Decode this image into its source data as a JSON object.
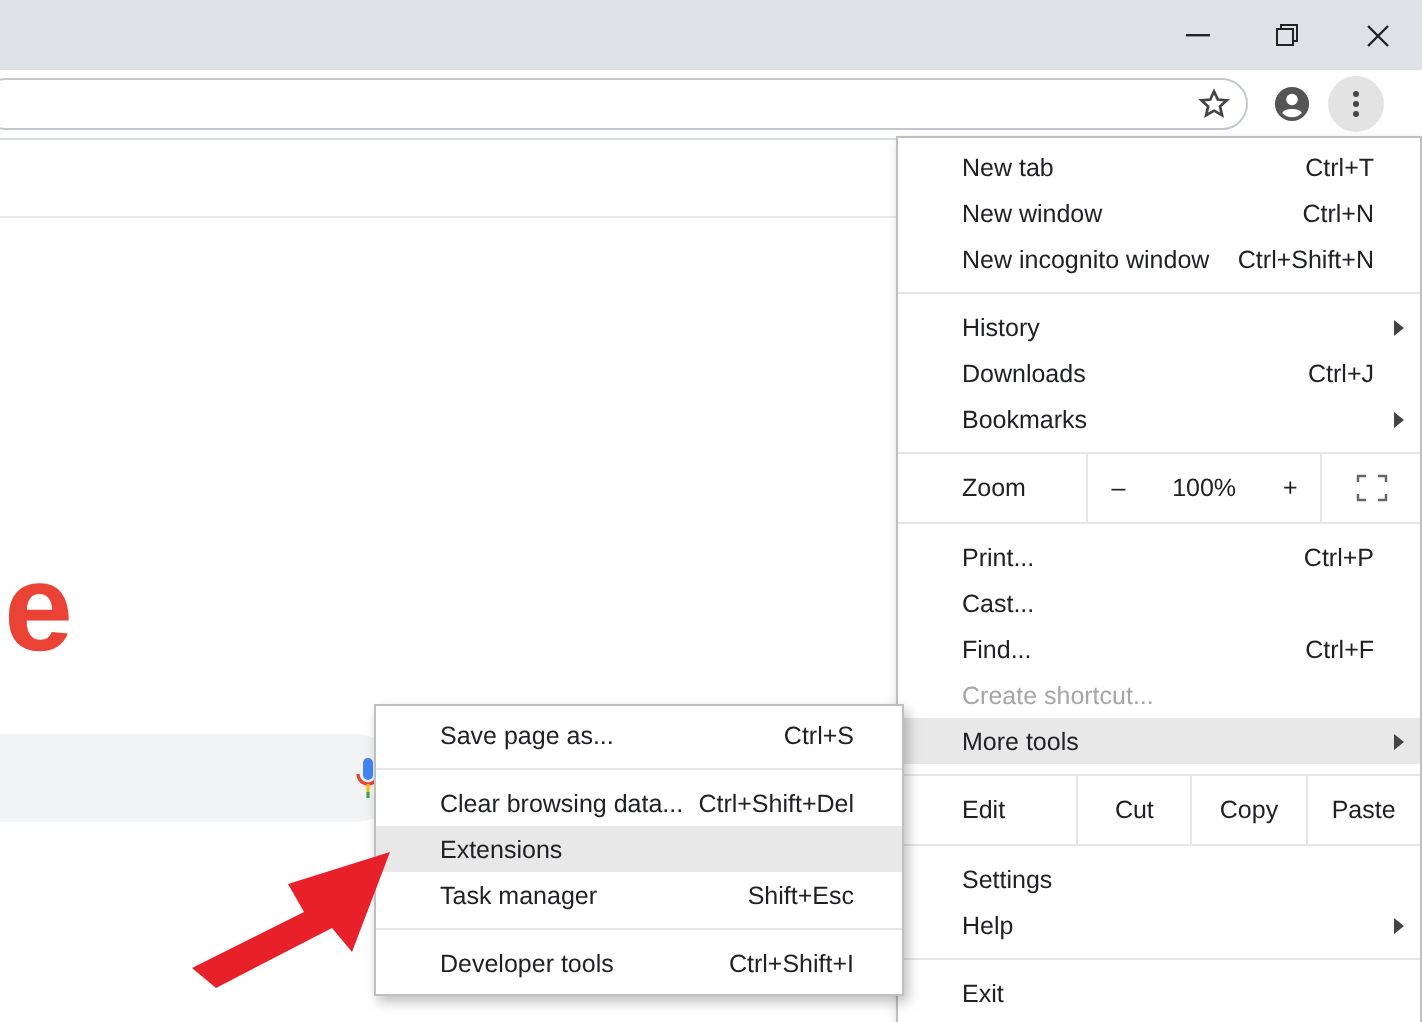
{
  "page": {
    "logo_text": "e"
  },
  "menu": {
    "groups": [
      {
        "items": [
          {
            "kind": "item",
            "label": "New tab",
            "shortcut": "Ctrl+T",
            "submenu": false,
            "disabled": false,
            "selected": false
          },
          {
            "kind": "item",
            "label": "New window",
            "shortcut": "Ctrl+N",
            "submenu": false,
            "disabled": false,
            "selected": false
          },
          {
            "kind": "item",
            "label": "New incognito window",
            "shortcut": "Ctrl+Shift+N",
            "submenu": false,
            "disabled": false,
            "selected": false
          }
        ]
      },
      {
        "items": [
          {
            "kind": "item",
            "label": "History",
            "submenu": true,
            "disabled": false,
            "selected": false
          },
          {
            "kind": "item",
            "label": "Downloads",
            "shortcut": "Ctrl+J",
            "submenu": false,
            "disabled": false,
            "selected": false
          },
          {
            "kind": "item",
            "label": "Bookmarks",
            "submenu": true,
            "disabled": false,
            "selected": false
          }
        ]
      },
      {
        "items": [
          {
            "kind": "zoom",
            "label": "Zoom",
            "minus": "–",
            "value": "100%",
            "plus": "+"
          }
        ]
      },
      {
        "items": [
          {
            "kind": "item",
            "label": "Print...",
            "shortcut": "Ctrl+P",
            "submenu": false,
            "disabled": false,
            "selected": false
          },
          {
            "kind": "item",
            "label": "Cast...",
            "submenu": false,
            "disabled": false,
            "selected": false
          },
          {
            "kind": "item",
            "label": "Find...",
            "shortcut": "Ctrl+F",
            "submenu": false,
            "disabled": false,
            "selected": false
          },
          {
            "kind": "item",
            "label": "Create shortcut...",
            "submenu": false,
            "disabled": true,
            "selected": false
          },
          {
            "kind": "item",
            "label": "More tools",
            "submenu": true,
            "disabled": false,
            "selected": true
          }
        ]
      },
      {
        "items": [
          {
            "kind": "edit",
            "label": "Edit",
            "buttons": [
              "Cut",
              "Copy",
              "Paste"
            ]
          }
        ]
      },
      {
        "items": [
          {
            "kind": "item",
            "label": "Settings",
            "submenu": false,
            "disabled": false,
            "selected": false
          },
          {
            "kind": "item",
            "label": "Help",
            "submenu": true,
            "disabled": false,
            "selected": false
          }
        ]
      },
      {
        "items": [
          {
            "kind": "item",
            "label": "Exit",
            "submenu": false,
            "disabled": false,
            "selected": false
          }
        ]
      }
    ]
  },
  "submenu": {
    "groups": [
      {
        "items": [
          {
            "kind": "item",
            "label": "Save page as...",
            "shortcut": "Ctrl+S",
            "submenu": false,
            "disabled": false,
            "selected": false
          }
        ]
      },
      {
        "items": [
          {
            "kind": "item",
            "label": "Clear browsing data...",
            "shortcut": "Ctrl+Shift+Del",
            "submenu": false,
            "disabled": false,
            "selected": false
          },
          {
            "kind": "item",
            "label": "Extensions",
            "submenu": false,
            "disabled": false,
            "selected": true
          },
          {
            "kind": "item",
            "label": "Task manager",
            "shortcut": "Shift+Esc",
            "submenu": false,
            "disabled": false,
            "selected": false
          }
        ]
      },
      {
        "items": [
          {
            "kind": "item",
            "label": "Developer tools",
            "shortcut": "Ctrl+Shift+I",
            "submenu": false,
            "disabled": false,
            "selected": false
          }
        ]
      }
    ]
  }
}
